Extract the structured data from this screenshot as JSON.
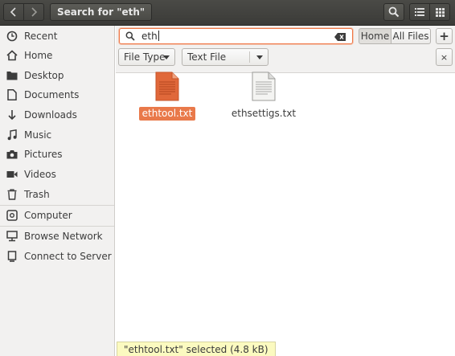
{
  "header": {
    "path_label": "Search for \"eth\"",
    "back_icon": "chevron-left-icon",
    "forward_icon": "chevron-right-icon",
    "search_icon": "search-icon",
    "list_view_icon": "list-view-icon",
    "grid_view_icon": "grid-view-icon"
  },
  "sidebar": {
    "items": [
      {
        "label": "Recent",
        "icon": "clock-icon"
      },
      {
        "label": "Home",
        "icon": "home-icon"
      },
      {
        "label": "Desktop",
        "icon": "folder-icon"
      },
      {
        "label": "Documents",
        "icon": "document-icon"
      },
      {
        "label": "Downloads",
        "icon": "download-icon"
      },
      {
        "label": "Music",
        "icon": "music-icon"
      },
      {
        "label": "Pictures",
        "icon": "camera-icon"
      },
      {
        "label": "Videos",
        "icon": "video-icon"
      },
      {
        "label": "Trash",
        "icon": "trash-icon"
      },
      {
        "label": "Computer",
        "icon": "drive-icon"
      },
      {
        "label": "Browse Network",
        "icon": "network-icon"
      },
      {
        "label": "Connect to Server",
        "icon": "server-icon"
      }
    ]
  },
  "search": {
    "query": "eth",
    "location_home": "Home",
    "location_all": "All Files",
    "add_label": "+",
    "criteria_type": "File Type",
    "criteria_value": "Text File",
    "remove_label": "×"
  },
  "files": [
    {
      "name": "ethtool.txt",
      "selected": true
    },
    {
      "name": "ethsettigs.txt",
      "selected": false
    }
  ],
  "status": "\"ethtool.txt\" selected  (4.8 kB)",
  "colors": {
    "accent": "#e9794a",
    "header": "#3b3b38",
    "sidebar": "#f2f1f0",
    "status_bg": "#fbfac0"
  }
}
